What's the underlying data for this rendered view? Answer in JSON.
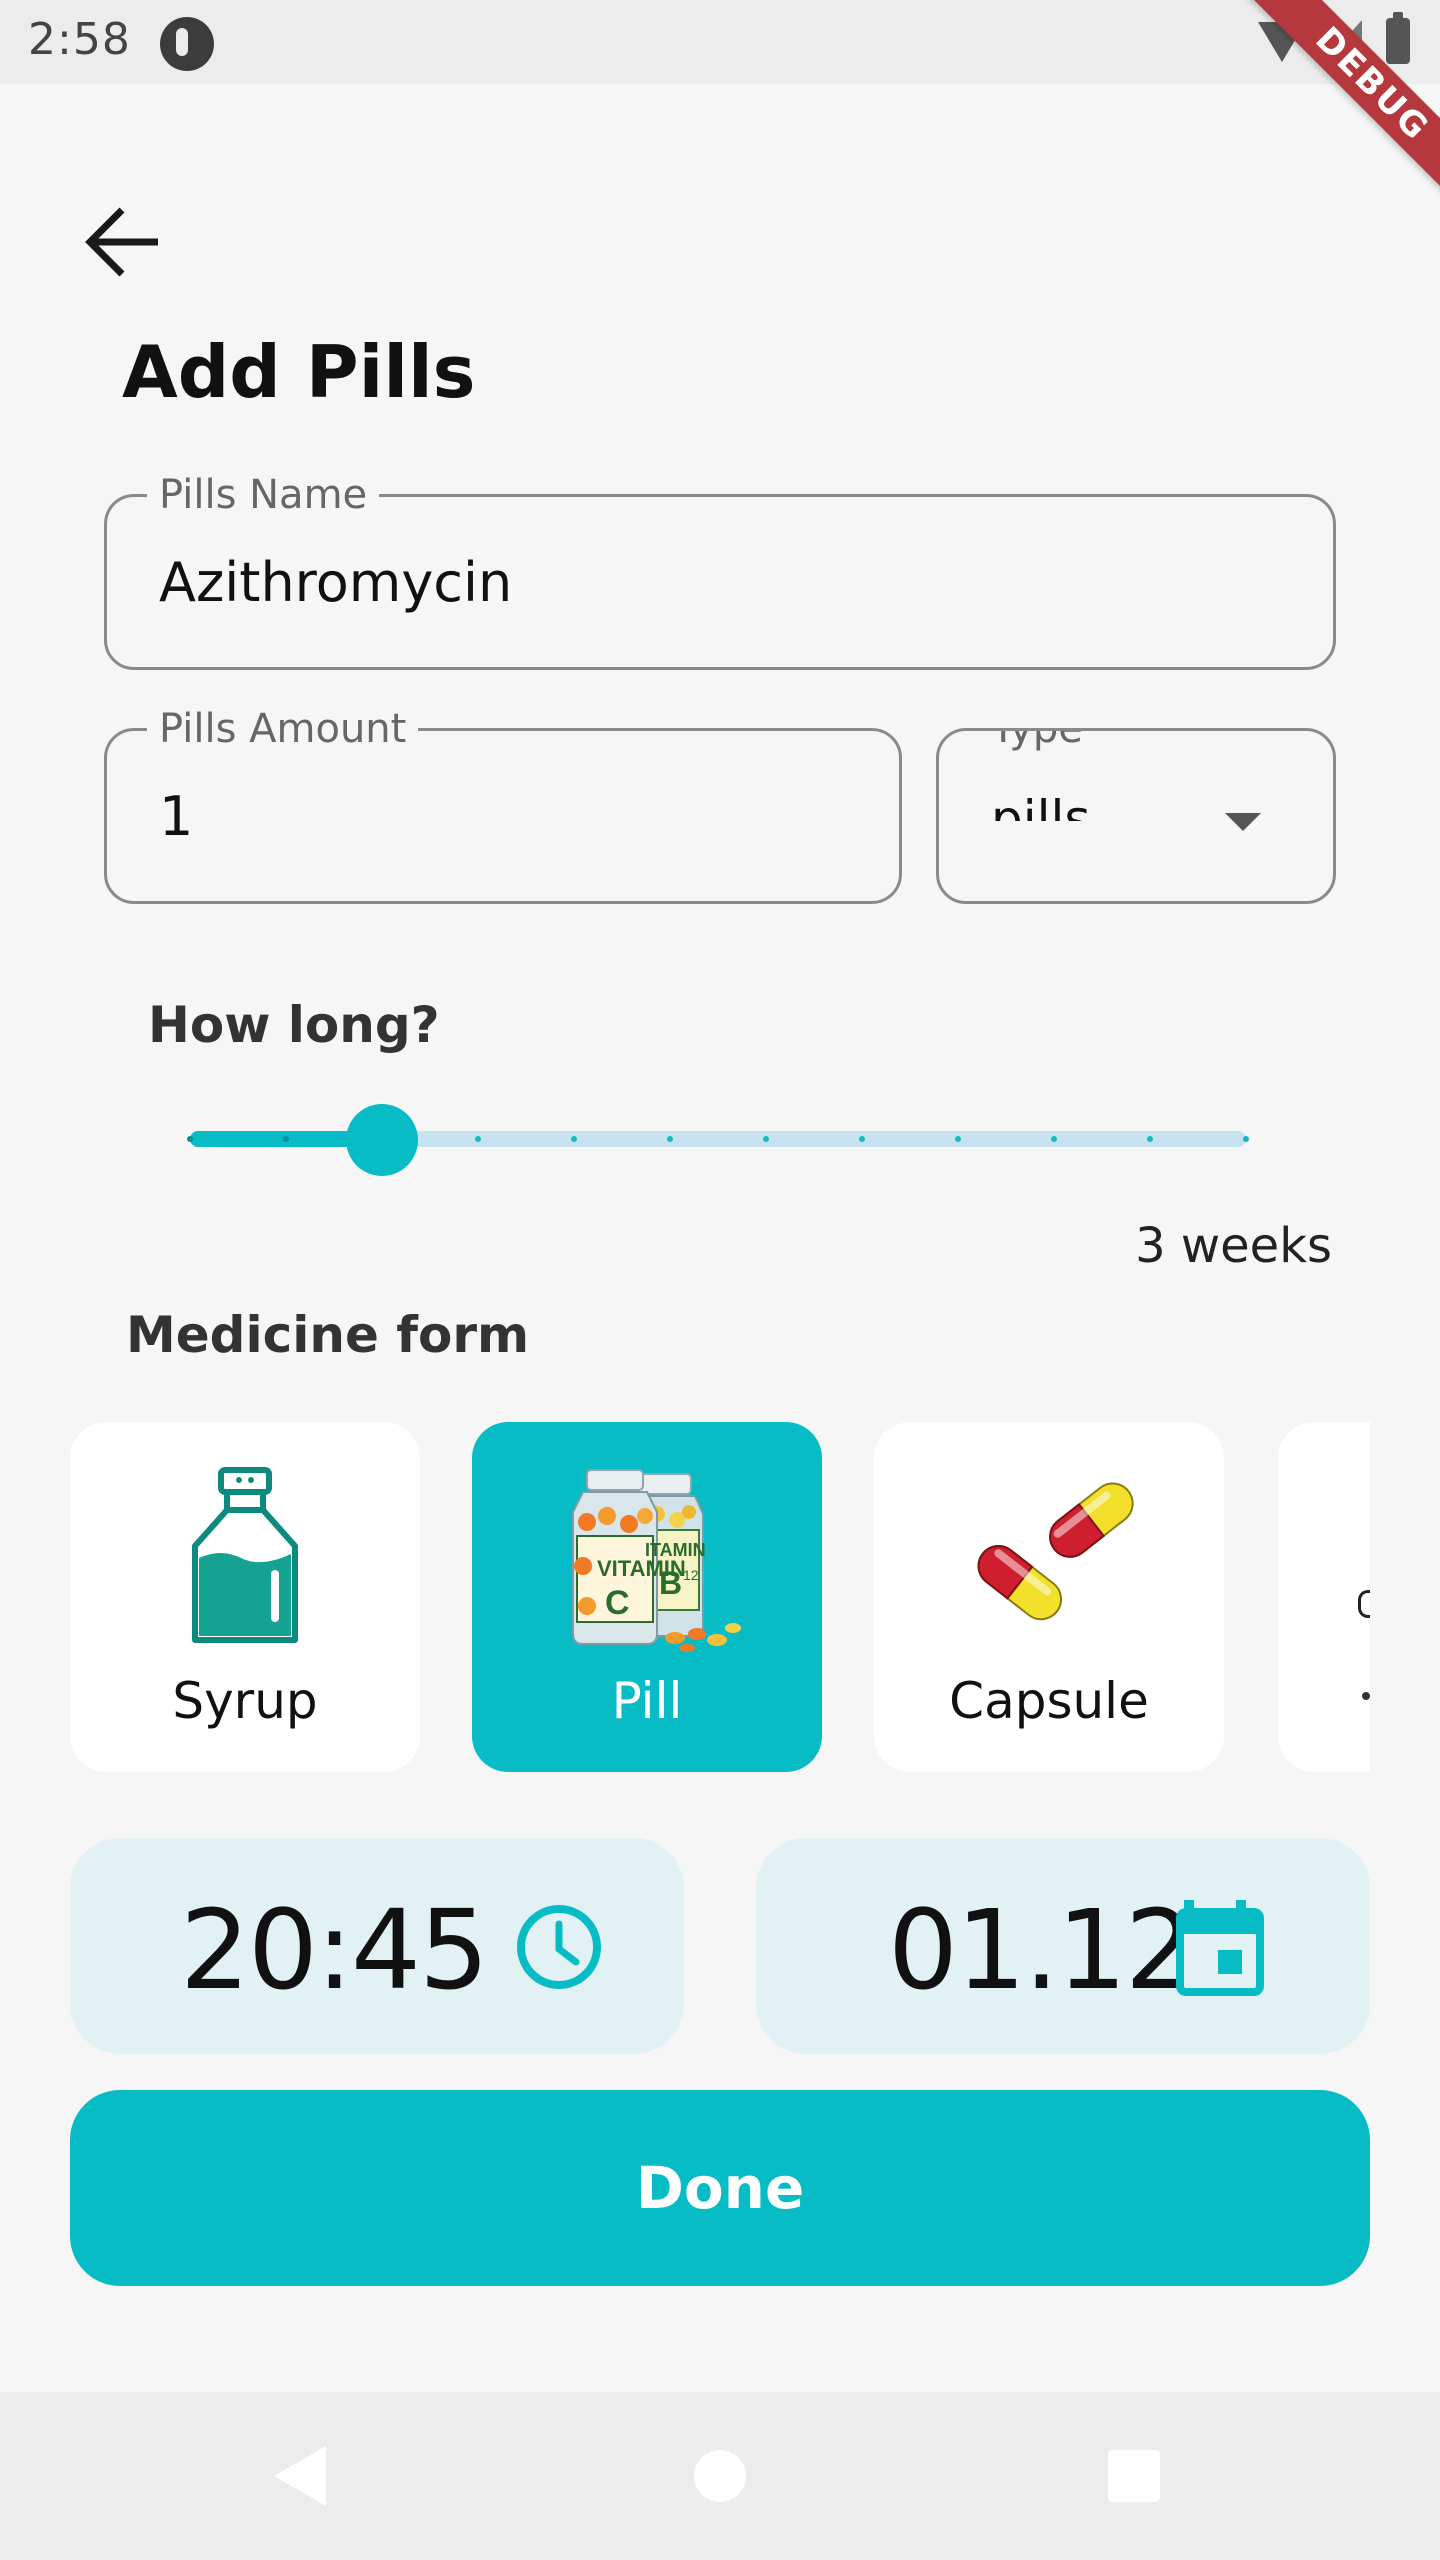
{
  "status_bar": {
    "time": "2:58"
  },
  "debug_banner": "DEBUG",
  "page": {
    "title": "Add Pills"
  },
  "form": {
    "name": {
      "label": "Pills Name",
      "value": "Azithromycin"
    },
    "amount": {
      "label": "Pills Amount",
      "value": "1"
    },
    "type": {
      "label": "Type",
      "value": "pills"
    }
  },
  "duration": {
    "heading": "How long?",
    "value_label": "3 weeks",
    "slider": {
      "steps": 12,
      "selected_index": 2
    }
  },
  "medicine_form": {
    "heading": "Medicine form",
    "options": [
      {
        "label": "Syrup",
        "icon": "syrup-bottle-icon",
        "selected": false
      },
      {
        "label": "Pill",
        "icon": "vitamin-pill-bottles-icon",
        "selected": true
      },
      {
        "label": "Capsule",
        "icon": "capsule-icon",
        "selected": false
      }
    ]
  },
  "schedule": {
    "time": {
      "value": "20:45",
      "icon": "clock-icon"
    },
    "date": {
      "value": "01.12",
      "icon": "calendar-icon"
    }
  },
  "done_button": {
    "label": "Done"
  },
  "colors": {
    "accent": "#08bcc6",
    "accent_light": "#e1f1f4",
    "background": "#f6f6f6"
  }
}
